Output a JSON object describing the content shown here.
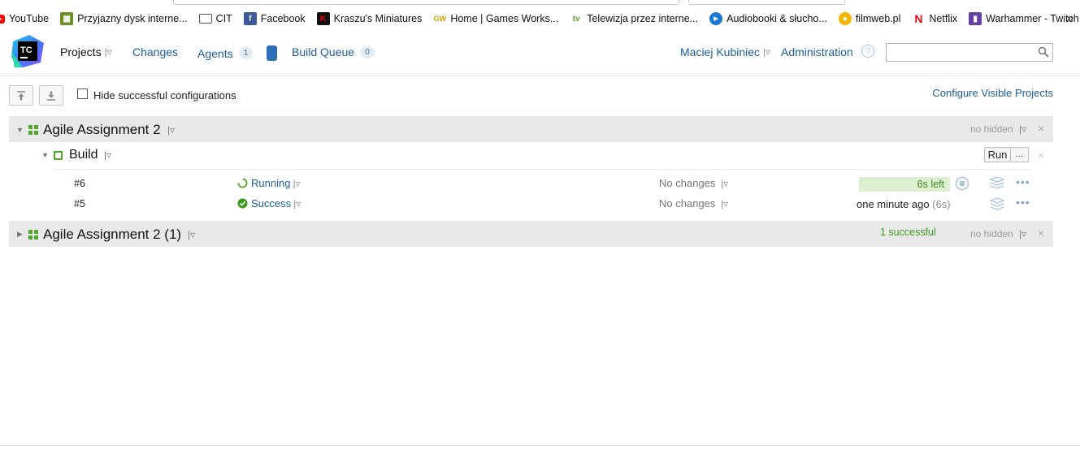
{
  "bookmarks": [
    {
      "label": "YouTube",
      "icon": "youtube-icon",
      "color": "#ff0000"
    },
    {
      "label": "Przyjazny dysk interne...",
      "icon": "drive-icon",
      "color": "#6b8e23"
    },
    {
      "label": "CIT",
      "icon": "folder-icon",
      "color": "#555555"
    },
    {
      "label": "Facebook",
      "icon": "facebook-icon",
      "color": "#3b5998"
    },
    {
      "label": "Kraszu's Miniatures",
      "icon": "k-icon",
      "color": "#b50000"
    },
    {
      "label": "Home | Games Works...",
      "icon": "gw-icon",
      "color": "#c9a100"
    },
    {
      "label": "Telewizja przez interne...",
      "icon": "tv-icon",
      "color": "#5a9e2e"
    },
    {
      "label": "Audiobooki & słucho...",
      "icon": "play-icon",
      "color": "#1976d2"
    },
    {
      "label": "filmweb.pl",
      "icon": "film-icon",
      "color": "#f5b800"
    },
    {
      "label": "Netflix",
      "icon": "netflix-icon",
      "color": "#e50914"
    },
    {
      "label": "Warhammer - Twitch",
      "icon": "twitch-icon",
      "color": "#6441a5"
    }
  ],
  "header": {
    "logo_text": "TC",
    "projects": "Projects",
    "changes": "Changes",
    "agents": "Agents",
    "agents_count": "1",
    "build_queue": "Build Queue",
    "queue_count": "0",
    "user": "Maciej Kubiniec",
    "administration": "Administration",
    "help": "?",
    "search_value": ""
  },
  "toolbar": {
    "hide_label": "Hide successful configurations",
    "hide_checked": false,
    "configure": "Configure Visible Projects"
  },
  "projects": [
    {
      "name": "Agile Assignment 2",
      "expanded": true,
      "no_hidden": "no hidden",
      "build_configs": [
        {
          "name": "Build",
          "run_label": "Run",
          "run_more": "...",
          "builds": [
            {
              "number": "#6",
              "status": "Running",
              "changes": "No changes",
              "progress_text": "6s left"
            },
            {
              "number": "#5",
              "status": "Success",
              "changes": "No changes",
              "finished": "one minute ago",
              "duration": "(6s)"
            }
          ]
        }
      ]
    },
    {
      "name": "Agile Assignment 2 (1)",
      "expanded": false,
      "summary": "1 successful",
      "no_hidden": "no hidden"
    }
  ],
  "colors": {
    "link": "#1a5e9e",
    "success": "#3a9a1e",
    "progress_bg": "#dcf0d1",
    "project_bg": "#e9e9e9"
  }
}
